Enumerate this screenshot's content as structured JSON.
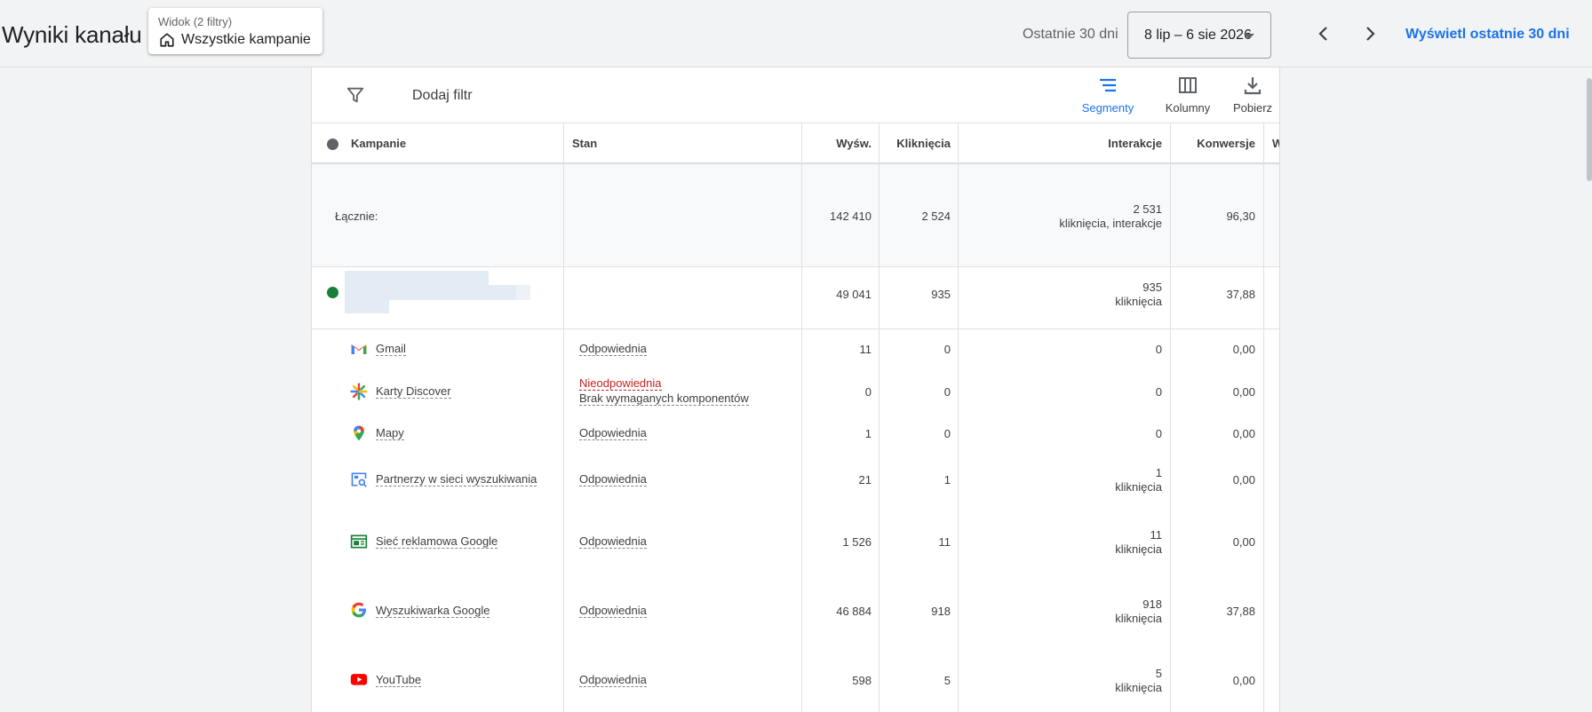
{
  "header": {
    "title": "Wyniki kanału",
    "view": {
      "label": "Widok (2 filtry)",
      "value": "Wszystkie kampanie",
      "icon": "home-icon"
    },
    "date_caption": "Ostatnie 30 dni",
    "date_range": "8 lip – 6 sie 2026",
    "show_last_30": "Wyświetl ostatnie 30 dni"
  },
  "toolbar": {
    "add_filter": "Dodaj filtr",
    "segments": "Segmenty",
    "columns": "Kolumny",
    "download": "Pobierz"
  },
  "table": {
    "headers": {
      "campaigns": "Kampanie",
      "status": "Stan",
      "impressions": "Wyśw.",
      "clicks": "Kliknięcia",
      "interactions": "Interakcje",
      "conversions": "Konwersje",
      "cut_off": "W"
    },
    "total": {
      "label": "Łącznie:",
      "impressions": "142 410",
      "clicks": "2 524",
      "interactions": "2 531",
      "interactions_type": "kliknięcia, interakcje",
      "conversions": "96,30"
    },
    "campaign": {
      "impressions": "49 041",
      "clicks": "935",
      "interactions": "935",
      "interactions_type": "kliknięcia",
      "conversions": "37,88"
    },
    "networks": [
      {
        "name": "Gmail",
        "icon": "gmail-icon",
        "status": "Odpowiednia",
        "impressions": "11",
        "clicks": "0",
        "interactions": "0",
        "conversions": "0,00"
      },
      {
        "name": "Karty Discover",
        "icon": "discover-icon",
        "status": "Nieodpowiednia",
        "status_reason": "Brak wymaganych komponentów",
        "impressions": "0",
        "clicks": "0",
        "interactions": "0",
        "conversions": "0,00"
      },
      {
        "name": "Mapy",
        "icon": "maps-pin-icon",
        "status": "Odpowiednia",
        "impressions": "1",
        "clicks": "0",
        "interactions": "0",
        "conversions": "0,00"
      },
      {
        "name": "Partnerzy w sieci wyszukiwania",
        "icon": "search-partners-icon",
        "status": "Odpowiednia",
        "impressions": "21",
        "clicks": "1",
        "interactions": "1",
        "interactions_type": "kliknięcia",
        "conversions": "0,00"
      },
      {
        "name": "Sieć reklamowa Google",
        "icon": "display-network-icon",
        "status": "Odpowiednia",
        "impressions": "1 526",
        "clicks": "11",
        "interactions": "11",
        "interactions_type": "kliknięcia",
        "conversions": "0,00"
      },
      {
        "name": "Wyszukiwarka Google",
        "icon": "google-g-icon",
        "status": "Odpowiednia",
        "impressions": "46 884",
        "clicks": "918",
        "interactions": "918",
        "interactions_type": "kliknięcia",
        "conversions": "37,88"
      },
      {
        "name": "YouTube",
        "icon": "youtube-icon",
        "status": "Odpowiednia",
        "impressions": "598",
        "clicks": "5",
        "interactions": "5",
        "interactions_type": "kliknięcia",
        "conversions": "0,00"
      }
    ]
  },
  "colors": {
    "accent": "#1a73e8",
    "ok_status": "#3c4043",
    "bad_status": "#c5221f",
    "enabled_dot": "#188038"
  }
}
